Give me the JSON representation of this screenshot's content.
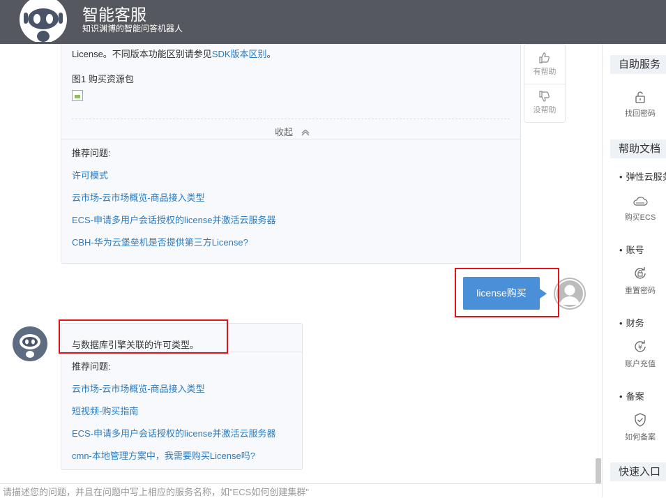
{
  "header": {
    "title": "智能客服",
    "subtitle": "知识渊博的智能问答机器人",
    "bg_color": "#55585e"
  },
  "chat": {
    "answer1": {
      "text_before": "License。不同版本功能区别请参见",
      "link": "SDK版本区别",
      "text_after": "。",
      "figure_caption": "图1 购买资源包",
      "collapse_label": "收起",
      "recommend_label": "推荐问题:",
      "recommendations": [
        "许可模式",
        "云市场-云市场概览-商品接入类型",
        "ECS-申请多用户会话授权的license并激活云服务器",
        "CBH-华为云堡垒机是否提供第三方License?"
      ]
    },
    "feedback": {
      "helpful": "有帮助",
      "not_helpful": "没帮助"
    },
    "user_message": {
      "text": "license购买",
      "bubble_color": "#4a90d9"
    },
    "answer2": {
      "text": "与数据库引擎关联的许可类型。",
      "recommend_label": "推荐问题:",
      "recommendations": [
        "云市场-云市场概览-商品接入类型",
        "短视频-购买指南",
        "ECS-申请多用户会话授权的license并激活云服务器",
        "cmn-本地管理方案中，我需要购买License吗?"
      ]
    },
    "highlight_color": "#e0141a",
    "link_color": "#2b7bc0"
  },
  "input": {
    "placeholder": "请描述您的问题，并且在问题中写上相应的服务名称，如\"ECS如何创建集群\""
  },
  "sidebar": {
    "self_service": {
      "title": "自助服务",
      "items": [
        {
          "label": "找回密码",
          "icon": "unlock-icon"
        }
      ]
    },
    "help_docs": {
      "title": "帮助文档",
      "categories": [
        {
          "name": "弹性云服务器",
          "item": "购买ECS",
          "icon": "cloud-icon"
        },
        {
          "name": "账号",
          "item": "重置密码",
          "icon": "refresh-lock-icon"
        },
        {
          "name": "财务",
          "item": "账户充值",
          "icon": "yen-refresh-icon"
        },
        {
          "name": "备案",
          "item": "如何备案",
          "icon": "shield-check-icon"
        }
      ]
    },
    "quick_entry": {
      "title": "快速入口"
    }
  }
}
